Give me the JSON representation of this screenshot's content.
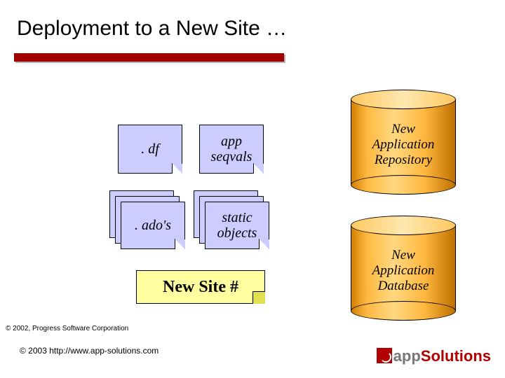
{
  "title": "Deployment to a New Site …",
  "files": {
    "df": ". df",
    "seqvals": "app\nseqvals",
    "ados": ". ado's",
    "static": "static\nobjects"
  },
  "sticky": "New Site #",
  "cylinders": {
    "repo": "New\nApplication\nRepository",
    "db": "New\nApplication\nDatabase"
  },
  "footer": {
    "line1": "© 2002, Progress Software Corporation",
    "line2": "© 2003 http://www.app-solutions.com"
  },
  "logo": {
    "part1": "app",
    "part2": "Solutions"
  }
}
